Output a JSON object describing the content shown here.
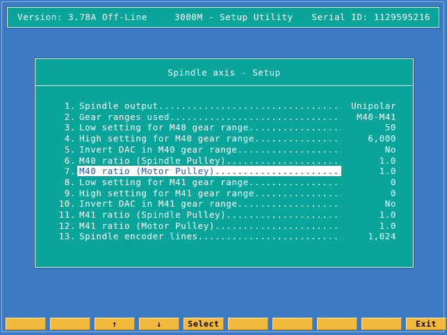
{
  "header": {
    "version": "Version: 3.78A Off-Line",
    "title": "3000M - Setup Utility",
    "serial": "Serial ID: 1129595216"
  },
  "dialog": {
    "title": "Spindle axis - Setup",
    "selected_index": 6,
    "items": [
      {
        "num": "1.",
        "label": "Spindle output",
        "value": "Unipolar"
      },
      {
        "num": "2.",
        "label": "Gear ranges used",
        "value": "M40-M41"
      },
      {
        "num": "3.",
        "label": "Low setting for M40 gear range",
        "value": "50"
      },
      {
        "num": "4.",
        "label": "High setting for M40 gear range",
        "value": "6,000"
      },
      {
        "num": "5.",
        "label": "Invert DAC in M40 gear range",
        "value": "No"
      },
      {
        "num": "6.",
        "label": "M40 ratio (Spindle Pulley)",
        "value": "1.0"
      },
      {
        "num": "7.",
        "label": "M40 ratio (Motor Pulley)",
        "value": "1.0"
      },
      {
        "num": "8.",
        "label": "Low setting for M41 gear range",
        "value": "0"
      },
      {
        "num": "9.",
        "label": "High setting for M41 gear range",
        "value": "0"
      },
      {
        "num": "10.",
        "label": "Invert DAC in M41 gear range",
        "value": "No"
      },
      {
        "num": "11.",
        "label": "M41 ratio (Spindle Pulley)",
        "value": "1.0"
      },
      {
        "num": "12.",
        "label": "M41 ratio (Motor Pulley)",
        "value": "1.0"
      },
      {
        "num": "13.",
        "label": "Spindle encoder lines",
        "value": "1,024"
      }
    ]
  },
  "function_keys": [
    {
      "label": "",
      "name": "fkey-1"
    },
    {
      "label": "",
      "name": "fkey-2"
    },
    {
      "label": "↑",
      "name": "up-arrow-icon"
    },
    {
      "label": "↓",
      "name": "down-arrow-icon"
    },
    {
      "label": "Select",
      "name": "select-button"
    },
    {
      "label": "",
      "name": "fkey-6"
    },
    {
      "label": "",
      "name": "fkey-7"
    },
    {
      "label": "",
      "name": "fkey-8"
    },
    {
      "label": "",
      "name": "fkey-9"
    },
    {
      "label": "Exit",
      "name": "exit-button"
    }
  ],
  "colors": {
    "background": "#3c7bc4",
    "panel": "#0aa59a",
    "highlight_text": "#1c56b8",
    "function_key": "#f2b93a"
  }
}
